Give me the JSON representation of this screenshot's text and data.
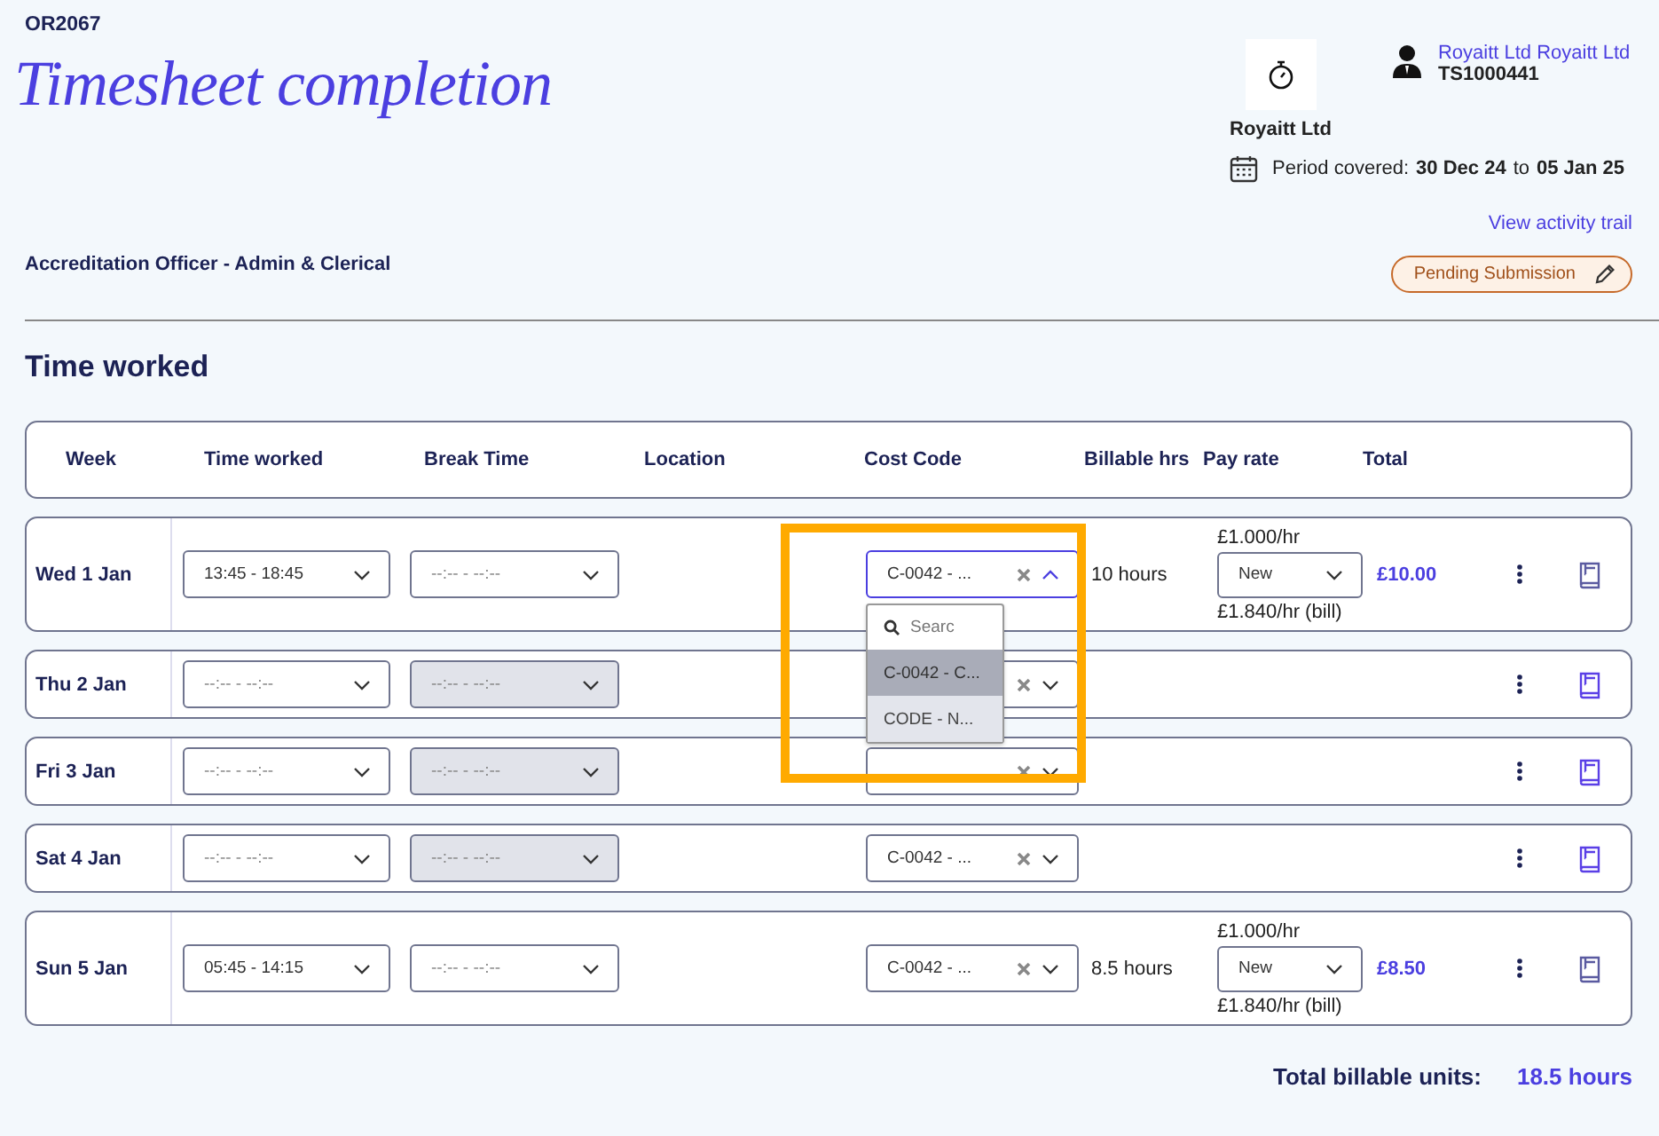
{
  "order_ref": "OR2067",
  "title": "Timesheet completion",
  "client": {
    "name": "Royaitt Ltd"
  },
  "user": {
    "name": "Royaitt Ltd Royaitt Ltd",
    "timesheet_id": "TS1000441"
  },
  "period": {
    "label": "Period covered:",
    "from": "30 Dec 24",
    "to_word": "to",
    "to": "05 Jan 25"
  },
  "activity_link": "View activity trail",
  "job_title": "Accreditation Officer - Admin & Clerical",
  "status": "Pending Submission",
  "section_title": "Time worked",
  "columns": [
    "Week",
    "Time worked",
    "Break Time",
    "Location",
    "Cost Code",
    "Billable hrs",
    "Pay rate",
    "Total"
  ],
  "rows": [
    {
      "day": "Wed 1 Jan",
      "time_worked": "13:45 - 18:45",
      "break_time": "--:-- - --:--",
      "break_disabled": false,
      "cost_code": "C-0042 - ...",
      "open": true,
      "billable": "10 hours",
      "pay": {
        "rate": "£1.000/hr",
        "status": "New",
        "bill": "£1.840/hr (bill)"
      },
      "total": "£10.00"
    },
    {
      "day": "Thu 2 Jan",
      "time_worked": "--:-- - --:--",
      "break_time": "--:-- - --:--",
      "break_disabled": true,
      "open": false
    },
    {
      "day": "Fri 3 Jan",
      "time_worked": "--:-- - --:--",
      "break_time": "--:-- - --:--",
      "break_disabled": true,
      "open": false
    },
    {
      "day": "Sat 4 Jan",
      "time_worked": "--:-- - --:--",
      "break_time": "--:-- - --:--",
      "break_disabled": true,
      "cost_code": "C-0042 - ...",
      "open": false
    },
    {
      "day": "Sun 5 Jan",
      "time_worked": "05:45 - 14:15",
      "break_time": "--:-- - --:--",
      "break_disabled": false,
      "cost_code": "C-0042 - ...",
      "open": false,
      "billable": "8.5 hours",
      "pay": {
        "rate": "£1.000/hr",
        "status": "New",
        "bill": "£1.840/hr (bill)"
      },
      "total": "£8.50"
    }
  ],
  "dropdown": {
    "placeholder": "Searc",
    "options": [
      {
        "label": "C-0042 - C...",
        "selected": true
      },
      {
        "label": "CODE - N...",
        "selected": false
      }
    ]
  },
  "highlight": true,
  "total_label": "Total billable units:",
  "total_value": "18.5 hours"
}
